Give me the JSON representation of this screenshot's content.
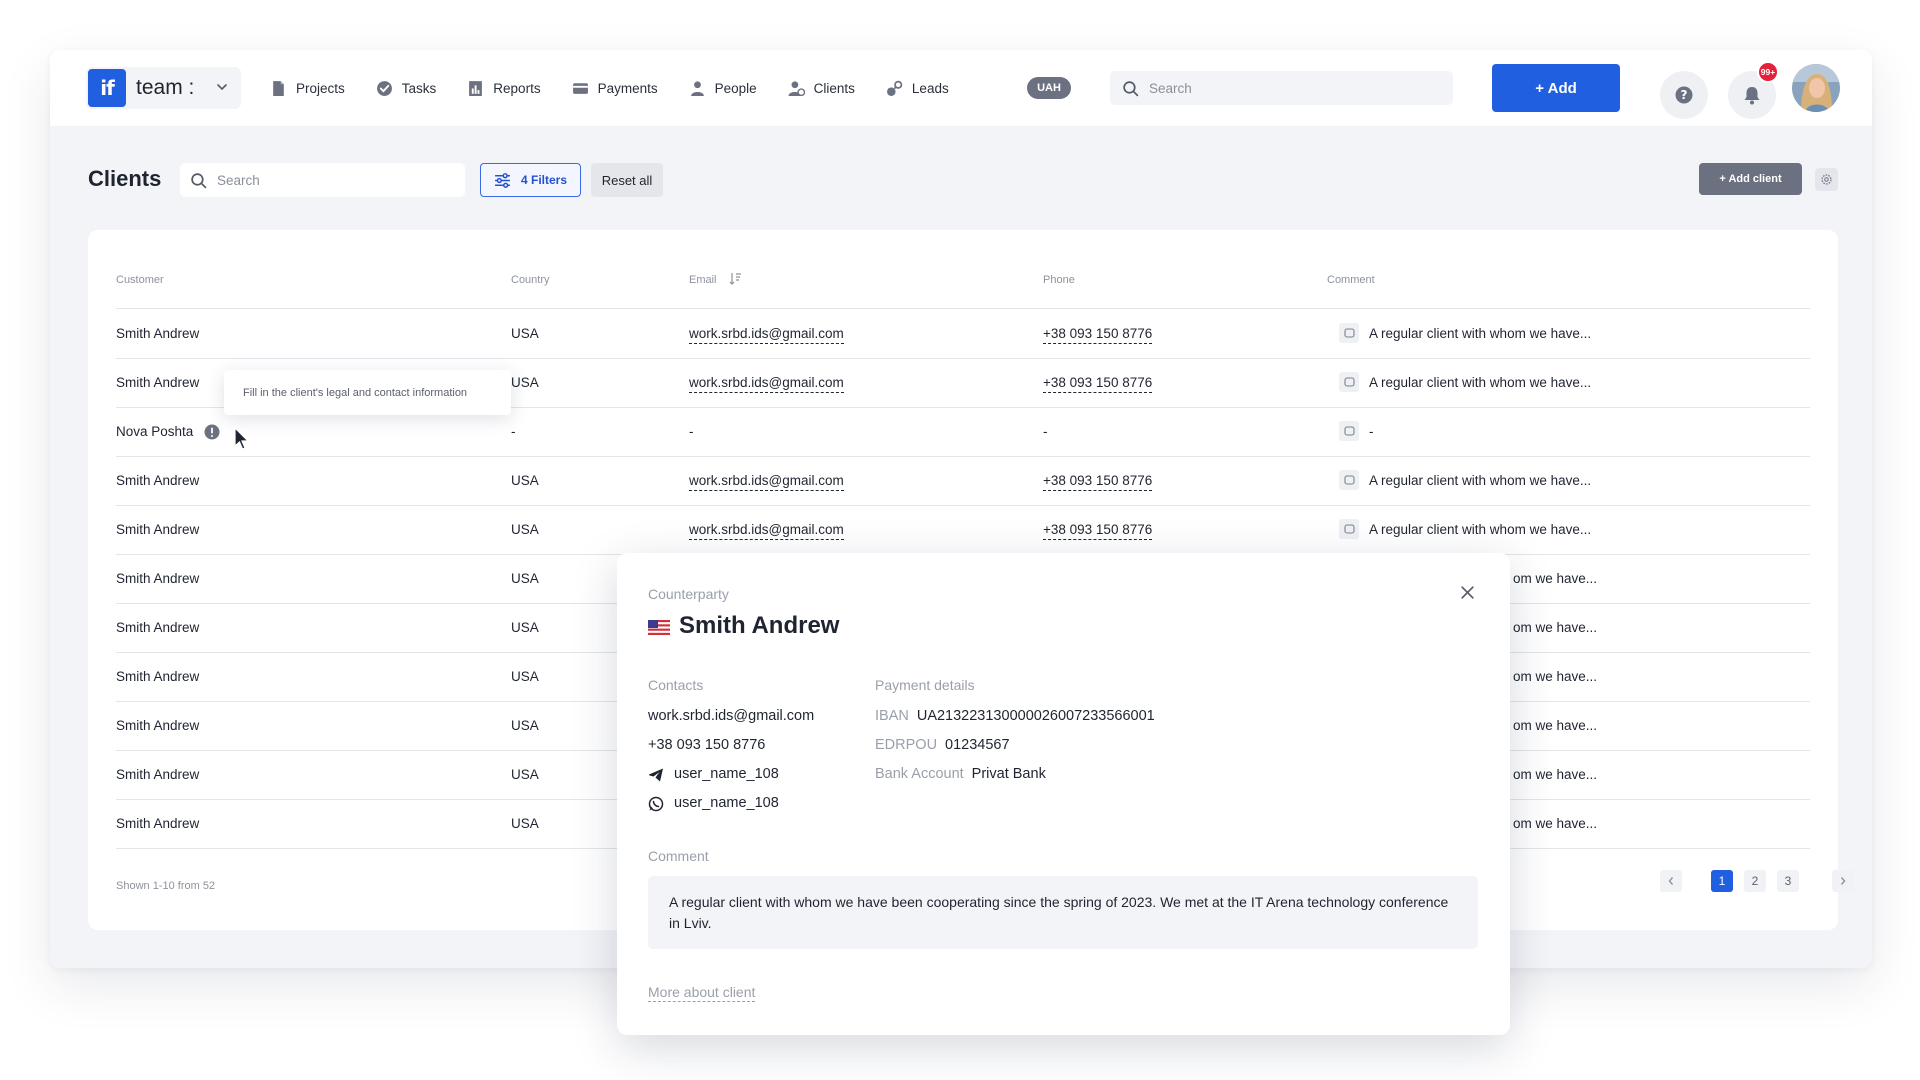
{
  "colors": {
    "primary": "#1f5fe0",
    "badge": "#e5203a",
    "neutral_button": "#6b7180"
  },
  "brand": {
    "logo_text": "if",
    "name": "team :"
  },
  "nav": {
    "items": [
      {
        "label": "Projects",
        "icon": "document-icon"
      },
      {
        "label": "Tasks",
        "icon": "check-circle-icon"
      },
      {
        "label": "Reports",
        "icon": "report-icon"
      },
      {
        "label": "Payments",
        "icon": "card-icon"
      },
      {
        "label": "People",
        "icon": "person-icon"
      },
      {
        "label": "Clients",
        "icon": "clients-icon"
      },
      {
        "label": "Leads",
        "icon": "leads-icon"
      }
    ],
    "currency": "UAH",
    "search_placeholder": "Search",
    "add_label": "+ Add",
    "help_label": "?",
    "notifications_badge": "99+"
  },
  "page": {
    "title": "Clients",
    "search_placeholder": "Search",
    "filters_label": "4 Filters",
    "reset_label": "Reset all",
    "add_client_label": "+ Add client"
  },
  "table": {
    "headers": {
      "customer": "Customer",
      "country": "Country",
      "email": "Email",
      "phone": "Phone",
      "comment": "Comment"
    },
    "rows": [
      {
        "customer": "Smith Andrew",
        "country": "USA",
        "email": "work.srbd.ids@gmail.com",
        "phone": "+38 093 150 8776",
        "comment": "A regular client with whom we have..."
      },
      {
        "customer": "Smith Andrew",
        "country": "USA",
        "email": "work.srbd.ids@gmail.com",
        "phone": "+38 093 150 8776",
        "comment": "A regular client with whom we have..."
      },
      {
        "customer": "Nova Poshta",
        "country": "-",
        "email": "-",
        "phone": "-",
        "comment": "-"
      },
      {
        "customer": "Smith Andrew",
        "country": "USA",
        "email": "work.srbd.ids@gmail.com",
        "phone": "+38 093 150 8776",
        "comment": "A regular client with whom we have..."
      },
      {
        "customer": "Smith Andrew",
        "country": "USA",
        "email": "work.srbd.ids@gmail.com",
        "phone": "+38 093 150 8776",
        "comment": "A regular client with whom we have..."
      },
      {
        "customer": "Smith Andrew",
        "country": "USA",
        "comment": "om we have..."
      },
      {
        "customer": "Smith Andrew",
        "country": "USA",
        "comment": "om we have..."
      },
      {
        "customer": "Smith Andrew",
        "country": "USA",
        "comment": "om we have..."
      },
      {
        "customer": "Smith Andrew",
        "country": "USA",
        "comment": "om we have..."
      },
      {
        "customer": "Smith Andrew",
        "country": "USA",
        "comment": "om we have..."
      },
      {
        "customer": "Smith Andrew",
        "country": "USA",
        "comment": "om we have..."
      }
    ],
    "footer": "Shown 1-10 from 52",
    "pages": [
      "1",
      "2",
      "3"
    ],
    "current_page": "1"
  },
  "tooltip": {
    "text": "Fill in the client's legal and contact information"
  },
  "modal": {
    "kicker": "Counterparty",
    "title": "Smith Andrew",
    "contacts_label": "Contacts",
    "email": "work.srbd.ids@gmail.com",
    "phone": "+38 093 150 8776",
    "telegram": "user_name_108",
    "whatsapp": "user_name_108",
    "payment_label": "Payment details",
    "iban_key": "IBAN",
    "iban": "UA213223130000026007233566001",
    "edrpou_key": "EDRPOU",
    "edrpou": "01234567",
    "bank_key": "Bank Account",
    "bank": "Privat Bank",
    "comment_label": "Comment",
    "comment": "A regular client with whom we have been cooperating since the spring of 2023. We met at the IT Arena technology conference in Lviv.",
    "more_link": "More about client"
  }
}
